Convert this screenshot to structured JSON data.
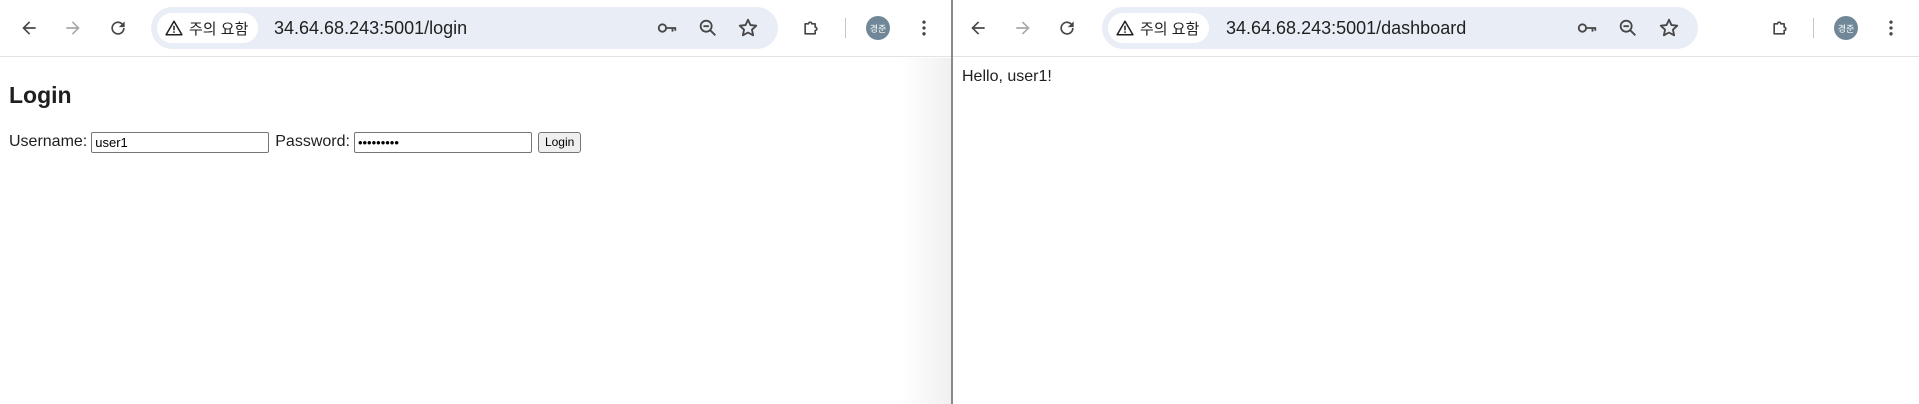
{
  "left_window": {
    "security_chip": "주의 요함",
    "url": "34.64.68.243:5001/login",
    "profile_initials": "경준",
    "page": {
      "title": "Login",
      "username_label": "Username:",
      "username_value": "user1",
      "password_label": "Password:",
      "password_value": "•••••••••",
      "login_button": "Login"
    }
  },
  "right_window": {
    "security_chip": "주의 요함",
    "url": "34.64.68.243:5001/dashboard",
    "profile_initials": "경준",
    "page": {
      "greeting": "Hello, user1!"
    }
  },
  "icons": {
    "back": "back-arrow-icon",
    "forward": "forward-arrow-icon",
    "reload": "reload-icon",
    "warning": "warning-triangle-icon",
    "key": "key-icon",
    "zoom": "zoom-out-icon",
    "bookmark": "star-icon",
    "extensions": "puzzle-icon",
    "menu": "kebab-menu-icon"
  },
  "colors": {
    "omnibox_bg": "#e9eef6",
    "avatar_bg": "#6f8796",
    "icon": "#474747"
  }
}
